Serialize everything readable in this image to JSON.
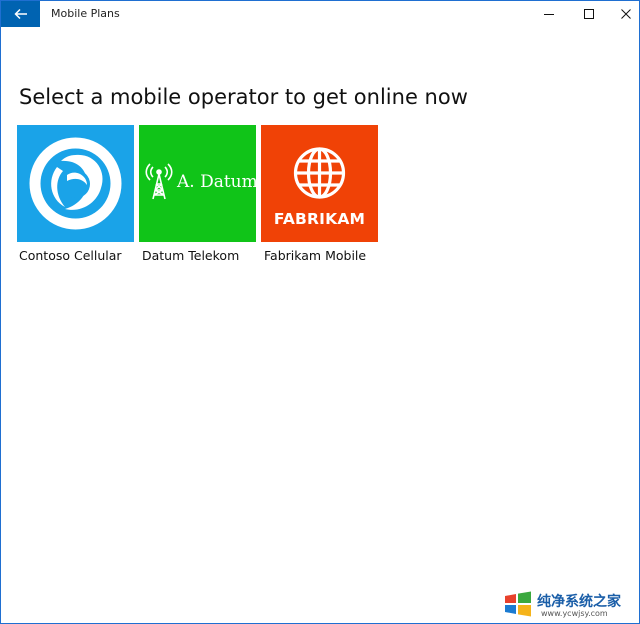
{
  "window": {
    "title": "Mobile Plans",
    "accent_color": "#0063b1",
    "icons": [
      "back-arrow-icon",
      "minimize-icon",
      "maximize-icon",
      "close-icon"
    ]
  },
  "main": {
    "heading": "Select a mobile operator to get online now",
    "operators": [
      {
        "label": "Contoso Cellular",
        "tile_color": "#1aa3e8",
        "icon": "contoso-logo-icon"
      },
      {
        "label": "Datum Telekom",
        "tile_color": "#10c418",
        "icon": "antenna-tower-icon",
        "logo_text": "A. Datum"
      },
      {
        "label": "Fabrikam Mobile",
        "tile_color": "#f04206",
        "icon": "globe-icon",
        "logo_text": "FABRIKAM"
      }
    ]
  },
  "watermark": {
    "text": "纯净系统之家",
    "url": "www.ycwjsy.com"
  }
}
